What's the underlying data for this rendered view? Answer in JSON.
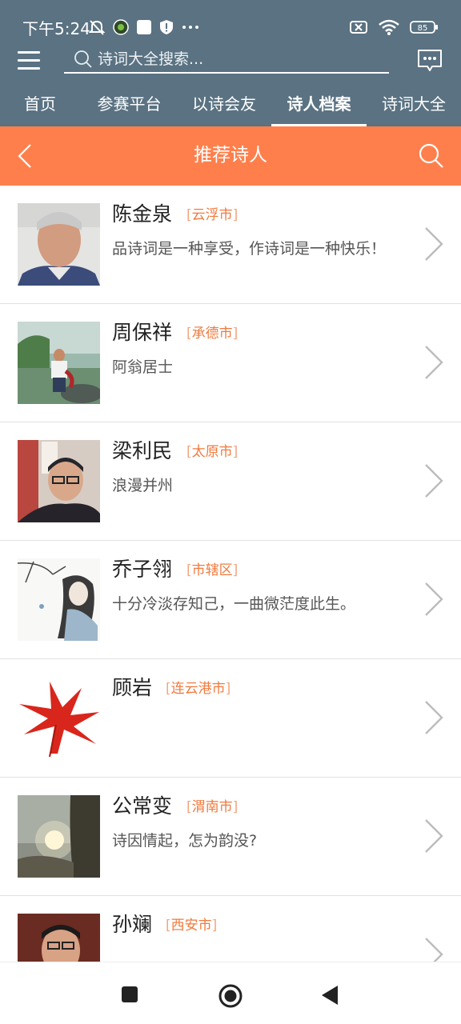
{
  "status_bar": {
    "time": "下午5:24",
    "battery": "85",
    "left_icons": [
      "mute-icon",
      "app-icon",
      "square-icon",
      "shield-icon",
      "more-dots-icon"
    ],
    "right_icons": [
      "sim-off-icon",
      "wifi-icon",
      "battery-icon"
    ]
  },
  "header": {
    "search_placeholder": "诗词大全搜索...",
    "tabs": [
      {
        "label": "首页",
        "active": false
      },
      {
        "label": "参赛平台",
        "active": false
      },
      {
        "label": "以诗会友",
        "active": false
      },
      {
        "label": "诗人档案",
        "active": true
      },
      {
        "label": "诗词大全",
        "active": false
      }
    ]
  },
  "titlebar": {
    "title": "推荐诗人"
  },
  "poets": [
    {
      "name": "陈金泉",
      "city": "云浮市",
      "motto": "品诗词是一种享受，作诗词是一种快乐！"
    },
    {
      "name": "周保祥",
      "city": "承德市",
      "motto": "阿翁居士"
    },
    {
      "name": "梁利民",
      "city": "太原市",
      "motto": "浪漫并州"
    },
    {
      "name": "乔子翎",
      "city": "市辖区",
      "motto": "十分冷淡存知己，一曲微茫度此生。"
    },
    {
      "name": "顾岩",
      "city": "连云港市",
      "motto": ""
    },
    {
      "name": "公常变",
      "city": "渭南市",
      "motto": "诗因情起，怎为韵没?"
    },
    {
      "name": "孙斓",
      "city": "西安市",
      "motto": ""
    }
  ],
  "colors": {
    "header_bg": "#5a7282",
    "titlebar_bg": "#ff7f4c",
    "city_text": "#f07a3e"
  }
}
